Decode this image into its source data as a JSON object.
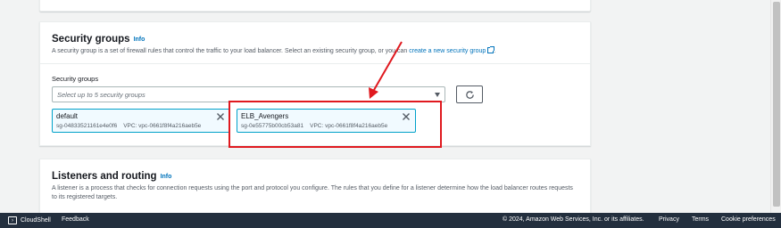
{
  "security_groups": {
    "title": "Security groups",
    "info": "Info",
    "description": "A security group is a set of firewall rules that control the traffic to your load balancer. Select an existing security group, or you can",
    "create_link": "create a new security group",
    "field_label": "Security groups",
    "select_placeholder": "Select up to 5 security groups",
    "selected": [
      {
        "name": "default",
        "id": "sg-04833521161e4e0f6",
        "vpc": "VPC: vpc-0661f8f4a216aeb5e"
      },
      {
        "name": "ELB_Avengers",
        "id": "sg-0e55775b00cb53a81",
        "vpc": "VPC: vpc-0661f8f4a216aeb5e"
      }
    ]
  },
  "listeners": {
    "title": "Listeners and routing",
    "info": "Info",
    "description_line1": "A listener is a process that checks for connection requests using the port and protocol you configure. The rules that you define for a listener determine how the load balancer routes requests",
    "description_line2": "to its registered targets."
  },
  "footer": {
    "cloudshell": "CloudShell",
    "feedback": "Feedback",
    "copyright": "© 2024, Amazon Web Services, Inc. or its affiliates.",
    "privacy": "Privacy",
    "terms": "Terms",
    "cookie": "Cookie preferences"
  },
  "colors": {
    "link": "#0073bb",
    "token_border": "#00a1c9",
    "token_bg": "#f1faff",
    "annotation": "#e0191f",
    "footer_bg": "#232f3e"
  },
  "icons": [
    "external-link-icon",
    "caret-down-icon",
    "refresh-icon",
    "close-icon",
    "cloudshell-icon"
  ]
}
